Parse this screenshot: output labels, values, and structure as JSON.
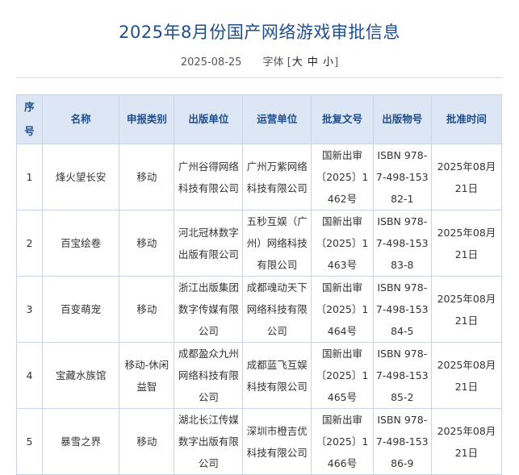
{
  "article": {
    "title": "2025年8月份国产网络游戏审批信息",
    "date": "2025-08-25",
    "font_size_label": "字体",
    "font_size_open": "[",
    "font_size_close": "]",
    "font_sizes": [
      "大",
      "中",
      "小"
    ]
  },
  "table": {
    "headers": [
      "序号",
      "名称",
      "申报类别",
      "出版单位",
      "运营单位",
      "批复文号",
      "出版物号",
      "批准时间"
    ],
    "rows": [
      {
        "no": "1",
        "name": "烽火望长安",
        "type": "移动",
        "publisher": "广州谷得网络科技有限公司",
        "operator": "广州万紫网络科技有限公司",
        "doc": "国新出审〔2025〕1462号",
        "isbn": "ISBN 978-7-498-15382-1",
        "date": "2025年08月21日"
      },
      {
        "no": "2",
        "name": "百宝绘卷",
        "type": "移动",
        "publisher": "河北冠林数字出版有限公司",
        "operator": "五秒互娱（广州）网络科技有限公司",
        "doc": "国新出审〔2025〕1463号",
        "isbn": "ISBN 978-7-498-15383-8",
        "date": "2025年08月21日"
      },
      {
        "no": "3",
        "name": "百变萌宠",
        "type": "移动",
        "publisher": "浙江出版集团数字传媒有限公司",
        "operator": "成都魂动天下网络科技有限公司",
        "doc": "国新出审〔2025〕1464号",
        "isbn": "ISBN 978-7-498-15384-5",
        "date": "2025年08月21日"
      },
      {
        "no": "4",
        "name": "宝藏水族馆",
        "type": "移动-休闲益智",
        "publisher": "成都盈众九州网络科技有限公司",
        "operator": "成都蓝飞互娱科技有限公司",
        "doc": "国新出审〔2025〕1465号",
        "isbn": "ISBN 978-7-498-15385-2",
        "date": "2025年08月21日"
      },
      {
        "no": "5",
        "name": "暴雪之界",
        "type": "移动",
        "publisher": "湖北长江传媒数字出版有限公司",
        "operator": "深圳市橙吉优科技有限公司",
        "doc": "国新出审〔2025〕1466号",
        "isbn": "ISBN 978-7-498-15386-9",
        "date": "2025年08月21日"
      }
    ]
  },
  "colors": {
    "title": "#1f4e8c",
    "header_bg": "#dde6f5",
    "header_text": "#1f4e8c",
    "border": "#c8d3e6"
  }
}
